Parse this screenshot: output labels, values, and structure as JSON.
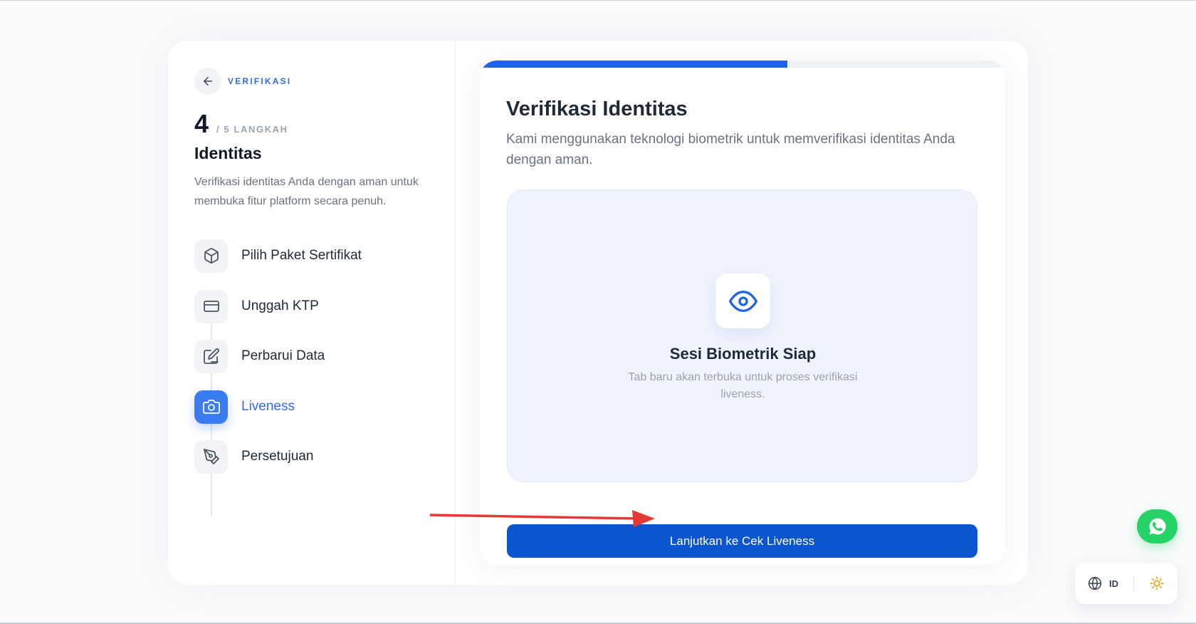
{
  "sidebar": {
    "back_label": "VERIFIKASI",
    "step_current": "4",
    "step_total": "/ 5 LANGKAH",
    "title": "Identitas",
    "description": "Verifikasi identitas Anda dengan aman untuk membuka fitur platform secara penuh.",
    "steps": [
      {
        "label": "Pilih Paket Sertifikat",
        "icon": "box-icon",
        "active": false
      },
      {
        "label": "Unggah KTP",
        "icon": "id-card-icon",
        "active": false
      },
      {
        "label": "Perbarui Data",
        "icon": "edit-icon",
        "active": false
      },
      {
        "label": "Liveness",
        "icon": "camera-icon",
        "active": true
      },
      {
        "label": "Persetujuan",
        "icon": "pen-tool-icon",
        "active": false
      }
    ]
  },
  "main": {
    "progress_fraction": 0.586,
    "title": "Verifikasi Identitas",
    "description": "Kami menggunakan teknologi biometrik untuk memverifikasi identitas Anda dengan aman.",
    "biometric": {
      "icon": "eye-icon",
      "title": "Sesi Biometrik Siap",
      "description": "Tab baru akan terbuka untuk proses verifikasi liveness."
    },
    "cta_label": "Lanjutkan ke Cek Liveness"
  },
  "floating": {
    "language_label": "ID",
    "whatsapp_icon": "whatsapp-icon",
    "theme_icon": "sun-icon"
  },
  "colors": {
    "accent": "#2f6bf0",
    "button": "#0b55cf",
    "progress": "#1f63e6",
    "whatsapp": "#25d366",
    "annotation_arrow": "#e53935",
    "sun": "#f59e0b"
  }
}
